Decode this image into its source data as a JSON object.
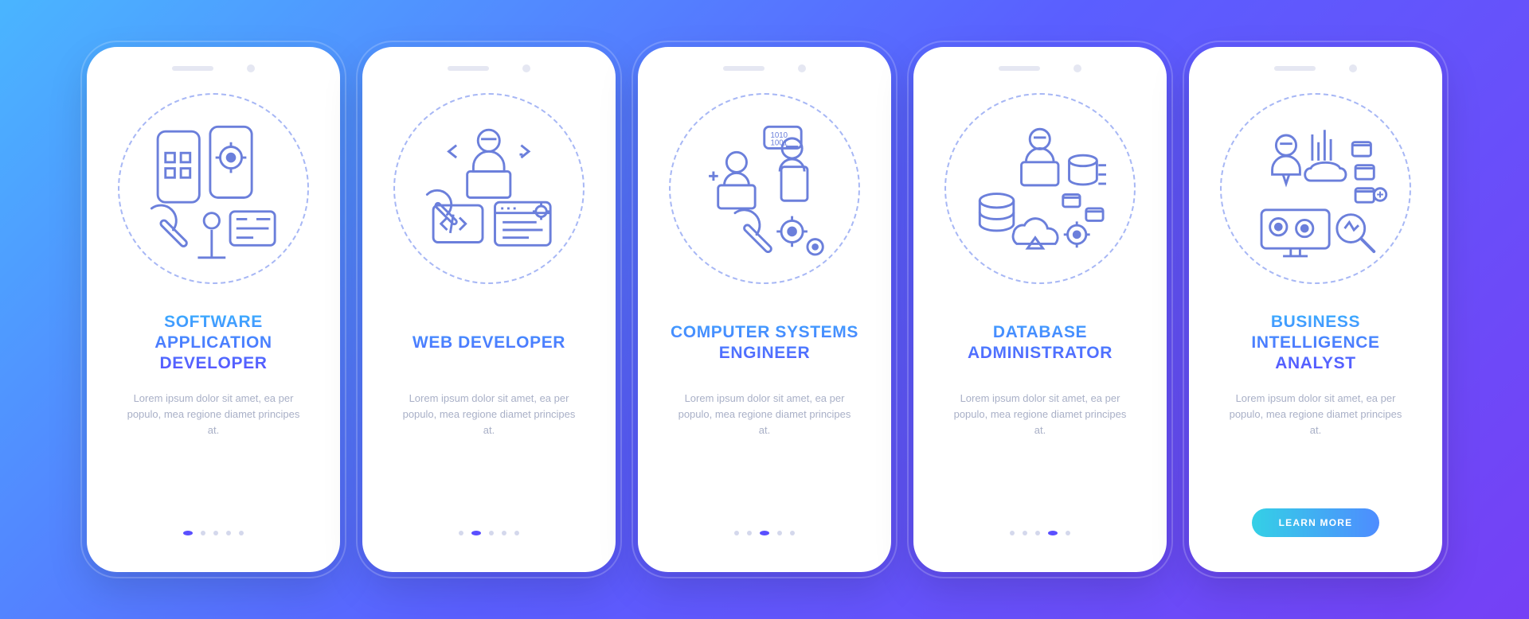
{
  "common_desc": "Lorem ipsum dolor sit amet, ea per populo, mea regione diamet principes at.",
  "cta_label": "LEARN MORE",
  "slides": [
    {
      "title": "SOFTWARE APPLICATION DEVELOPER",
      "icon": "software-dev-icon"
    },
    {
      "title": "WEB DEVELOPER",
      "icon": "web-dev-icon"
    },
    {
      "title": "COMPUTER SYSTEMS ENGINEER",
      "icon": "systems-engineer-icon"
    },
    {
      "title": "DATABASE ADMINISTRATOR",
      "icon": "database-admin-icon"
    },
    {
      "title": "BUSINESS INTELLIGENCE ANALYST",
      "icon": "bi-analyst-icon"
    }
  ],
  "page_count": 5
}
